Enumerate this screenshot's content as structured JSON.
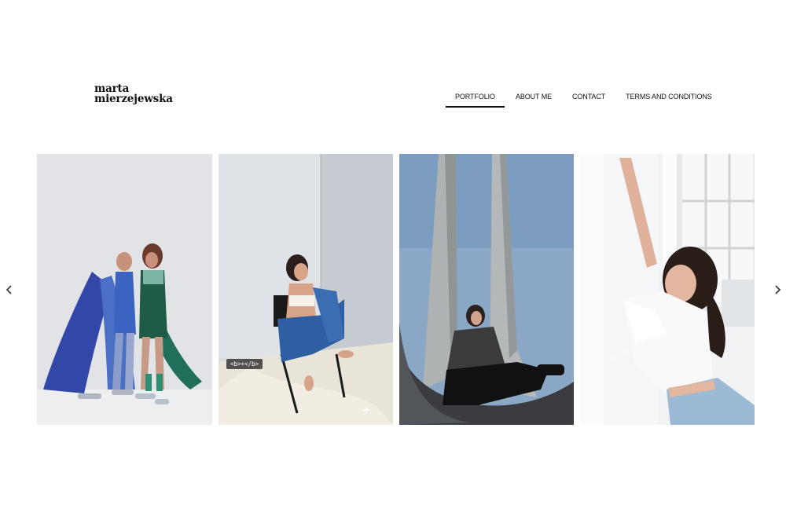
{
  "brand": {
    "line1": "marta",
    "line2": "mierzejewska"
  },
  "nav": {
    "items": [
      {
        "label": "PORTFOLIO",
        "active": true
      },
      {
        "label": "ABOUT ME",
        "active": false
      },
      {
        "label": "CONTACT",
        "active": false
      },
      {
        "label": "TERMS AND CONDITIONS",
        "active": false
      }
    ]
  },
  "gallery": {
    "photos": [
      {
        "subject": "two models in blue and green dresses against white studio wall"
      },
      {
        "subject": "model in denim seated on chair in white corner"
      },
      {
        "subject": "model seated beneath tall concrete spires against blue sky"
      },
      {
        "subject": "model in white top leaning against white wall by window"
      }
    ],
    "code_badge": "<b>+</b>",
    "plus_icon": "+"
  },
  "colors": {
    "accent": "#111111",
    "background": "#ffffff"
  }
}
